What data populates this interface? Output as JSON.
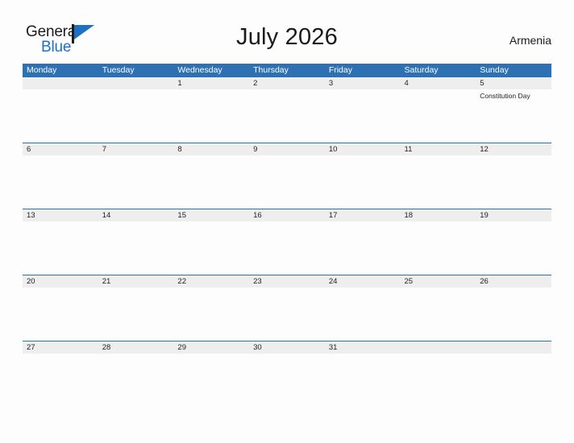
{
  "brand": {
    "name_part1": "General",
    "name_part2": "Blue",
    "flag_icon": "flag-icon",
    "accent_color": "#1f6fc4"
  },
  "header": {
    "title": "July 2026",
    "country": "Armenia"
  },
  "theme": {
    "header_blue": "#2d71b3",
    "band_gray": "#eeeeee",
    "page_background": "#fdfdfd",
    "text_color": "#222222"
  },
  "calendar": {
    "month": "July",
    "year": "2026",
    "weekday_headers": [
      "Monday",
      "Tuesday",
      "Wednesday",
      "Thursday",
      "Friday",
      "Saturday",
      "Sunday"
    ],
    "weeks": [
      [
        {
          "day": "",
          "event": ""
        },
        {
          "day": "",
          "event": ""
        },
        {
          "day": "1",
          "event": ""
        },
        {
          "day": "2",
          "event": ""
        },
        {
          "day": "3",
          "event": ""
        },
        {
          "day": "4",
          "event": ""
        },
        {
          "day": "5",
          "event": "Constitution Day"
        }
      ],
      [
        {
          "day": "6",
          "event": ""
        },
        {
          "day": "7",
          "event": ""
        },
        {
          "day": "8",
          "event": ""
        },
        {
          "day": "9",
          "event": ""
        },
        {
          "day": "10",
          "event": ""
        },
        {
          "day": "11",
          "event": ""
        },
        {
          "day": "12",
          "event": ""
        }
      ],
      [
        {
          "day": "13",
          "event": ""
        },
        {
          "day": "14",
          "event": ""
        },
        {
          "day": "15",
          "event": ""
        },
        {
          "day": "16",
          "event": ""
        },
        {
          "day": "17",
          "event": ""
        },
        {
          "day": "18",
          "event": ""
        },
        {
          "day": "19",
          "event": ""
        }
      ],
      [
        {
          "day": "20",
          "event": ""
        },
        {
          "day": "21",
          "event": ""
        },
        {
          "day": "22",
          "event": ""
        },
        {
          "day": "23",
          "event": ""
        },
        {
          "day": "24",
          "event": ""
        },
        {
          "day": "25",
          "event": ""
        },
        {
          "day": "26",
          "event": ""
        }
      ],
      [
        {
          "day": "27",
          "event": ""
        },
        {
          "day": "28",
          "event": ""
        },
        {
          "day": "29",
          "event": ""
        },
        {
          "day": "30",
          "event": ""
        },
        {
          "day": "31",
          "event": ""
        },
        {
          "day": "",
          "event": ""
        },
        {
          "day": "",
          "event": ""
        }
      ]
    ]
  }
}
